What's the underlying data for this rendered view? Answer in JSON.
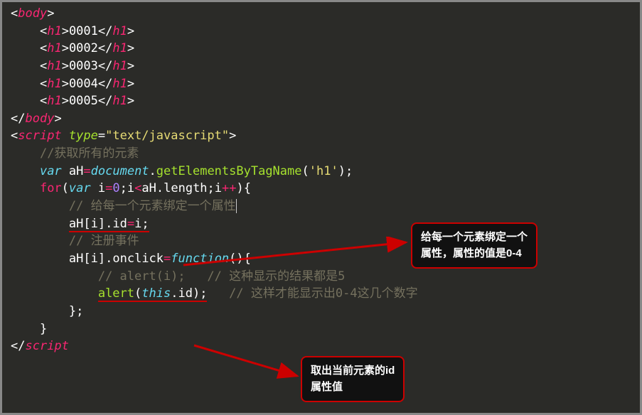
{
  "code": {
    "l1": {
      "open": "<",
      "tag": "body",
      "close": ">"
    },
    "l2": {
      "indent": "    ",
      "open": "<",
      "tag": "h1",
      "close": ">",
      "text": "0001",
      "open2": "</",
      "tag2": "h1",
      "close2": ">"
    },
    "l3": {
      "indent": "    ",
      "open": "<",
      "tag": "h1",
      "close": ">",
      "text": "0002",
      "open2": "</",
      "tag2": "h1",
      "close2": ">"
    },
    "l4": {
      "indent": "    ",
      "open": "<",
      "tag": "h1",
      "close": ">",
      "text": "0003",
      "open2": "</",
      "tag2": "h1",
      "close2": ">"
    },
    "l5": {
      "indent": "    ",
      "open": "<",
      "tag": "h1",
      "close": ">",
      "text": "0004",
      "open2": "</",
      "tag2": "h1",
      "close2": ">"
    },
    "l6": {
      "indent": "    ",
      "open": "<",
      "tag": "h1",
      "close": ">",
      "text": "0005",
      "open2": "</",
      "tag2": "h1",
      "close2": ">"
    },
    "l7": {
      "open": "</",
      "tag": "body",
      "close": ">"
    },
    "l8": {
      "open": "<",
      "tag": "script",
      "sp": " ",
      "attr": "type",
      "eq": "=",
      "str": "\"text/javascript\"",
      "close": ">"
    },
    "l9": {
      "indent": "    ",
      "comment": "//获取所有的元素"
    },
    "l10": {
      "indent": "    ",
      "var": "var",
      "sp": " ",
      "id": "aH",
      "op": "=",
      "obj": "document",
      "dot": ".",
      "fn": "getElementsByTagName",
      "lp": "(",
      "str": "'h1'",
      "rp": ")",
      ";": ";"
    },
    "l11": {
      "indent": "    ",
      "for": "for",
      "lp": "(",
      "var": "var",
      "sp": " ",
      "id": "i",
      "op1": "=",
      "num": "0",
      "sc1": ";",
      "id2": "i",
      "op2": "<",
      "id3": "aH",
      "dot": ".",
      "prop": "length",
      "sc2": ";",
      "id4": "i",
      "op3": "++",
      "rp": ")",
      "lb": "{"
    },
    "l12": {
      "indent": "        ",
      "comment": "// 给每一个元素绑定一个属性"
    },
    "l13": {
      "indent": "        ",
      "id": "aH",
      "lb": "[",
      "id2": "i",
      "rb": "]",
      "dot": ".",
      "prop": "id",
      "op": "=",
      "id3": "i",
      "sc": ";"
    },
    "l14": {
      "indent": "        ",
      "comment": "// 注册事件"
    },
    "l15": {
      "indent": "        ",
      "id": "aH",
      "lb": "[",
      "id2": "i",
      "rb": "]",
      "dot": ".",
      "prop": "onclick",
      "op": "=",
      "fn": "function",
      "lp": "(",
      "rp": ")",
      "lbr": "{"
    },
    "l16": {
      "indent": "            ",
      "comment1": "// alert(i);",
      "gap": "   ",
      "comment2": "// 这种显示的结果都是5"
    },
    "l17": {
      "indent": "            ",
      "fn": "alert",
      "lp": "(",
      "this": "this",
      "dot": ".",
      "prop": "id",
      "rp": ")",
      "sc": ";",
      "gap": "   ",
      "comment": "// 这样才能显示出0-4这几个数字"
    },
    "l18": {
      "indent": "        ",
      "rbr": "}",
      "sc": ";"
    },
    "l19": {
      "indent": "    ",
      "rbr": "}"
    },
    "l20": {
      "open": "</",
      "tag": "script"
    }
  },
  "callout1": {
    "line1": "给每一个元素绑定一个",
    "line2": "属性，属性的值是0-4"
  },
  "callout2": {
    "line1": "取出当前元素的id",
    "line2": "属性值"
  }
}
